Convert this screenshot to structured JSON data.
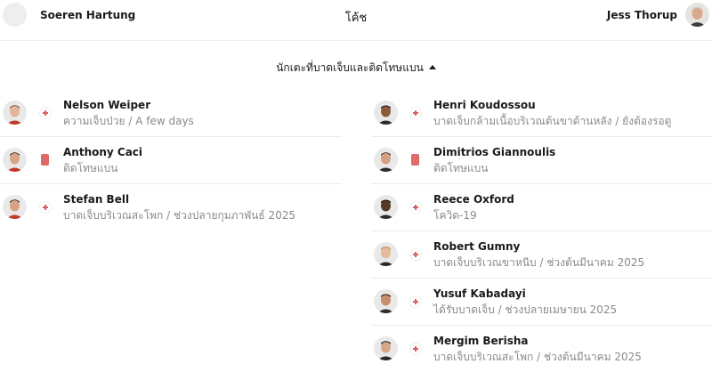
{
  "header": {
    "home_coach": "Soeren Hartung",
    "title": "โค้ช",
    "away_coach": "Jess Thorup"
  },
  "section": {
    "title": "นักเตะที่บาดเจ็บและติดโทษแบน",
    "expanded": true
  },
  "home_players": [
    {
      "name": "Nelson Weiper",
      "reason": "ความเจ็บป่วย / A few days",
      "status": "injury-icon"
    },
    {
      "name": "Anthony Caci",
      "reason": "ติดโทษแบน",
      "status": "red-card-icon"
    },
    {
      "name": "Stefan Bell",
      "reason": "บาดเจ็บบริเวณสะโพก / ช่วงปลายกุมภาพันธ์ 2025",
      "status": "injury-icon"
    }
  ],
  "away_players": [
    {
      "name": "Henri Koudossou",
      "reason": "บาดเจ็บกล้ามเนื้อบริเวณต้นขาด้านหลัง / ยังต้องรอดู",
      "status": "injury-icon"
    },
    {
      "name": "Dimitrios Giannoulis",
      "reason": "ติดโทษแบน",
      "status": "red-card-icon"
    },
    {
      "name": "Reece Oxford",
      "reason": "โควิด-19",
      "status": "injury-icon"
    },
    {
      "name": "Robert Gumny",
      "reason": "บาดเจ็บบริเวณขาหนีบ / ช่วงต้นมีนาคม 2025",
      "status": "injury-icon"
    },
    {
      "name": "Yusuf Kabadayi",
      "reason": "ได้รับบาดเจ็บ / ช่วงปลายเมษายน 2025",
      "status": "injury-icon"
    },
    {
      "name": "Mergim Berisha",
      "reason": "บาดเจ็บบริเวณสะโพก / ช่วงต้นมีนาคม 2025",
      "status": "injury-icon"
    }
  ],
  "colors": {
    "injury_cross": "#e05a5a",
    "red_card": "#e06a66",
    "reason_text": "#8a8a8a"
  }
}
